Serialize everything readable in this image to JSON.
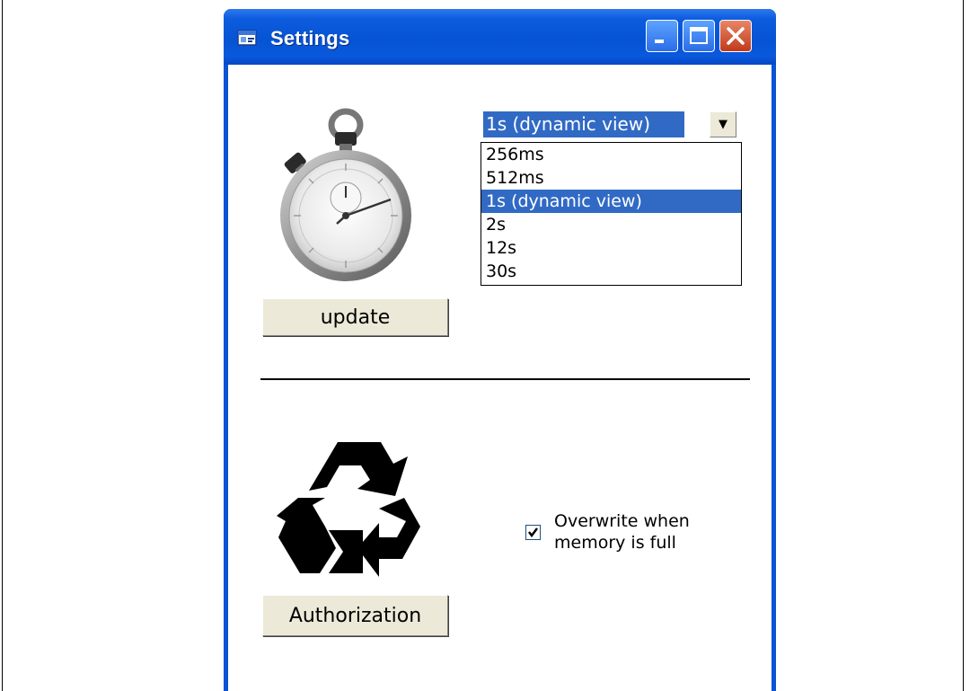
{
  "window": {
    "title": "Settings",
    "controls": [
      "minimize-icon",
      "maximize-icon",
      "close-icon"
    ]
  },
  "update_section": {
    "icon": "stopwatch-icon",
    "button_label": "update",
    "combo": {
      "selected": "1s  (dynamic view)",
      "options": [
        "256ms",
        "512ms",
        "1s  (dynamic view)",
        "2s",
        "12s",
        "30s"
      ],
      "highlighted_index": 2
    }
  },
  "memory_section": {
    "icon": "recycle-icon",
    "button_label": "Authorization",
    "checkbox": {
      "checked": true,
      "label_line1": "Overwrite when",
      "label_line2": "memory is full"
    }
  },
  "colors": {
    "titlebar": "#0554d4",
    "selection": "#316ac5",
    "button_face": "#ece9d8",
    "close_button": "#c0391b"
  }
}
